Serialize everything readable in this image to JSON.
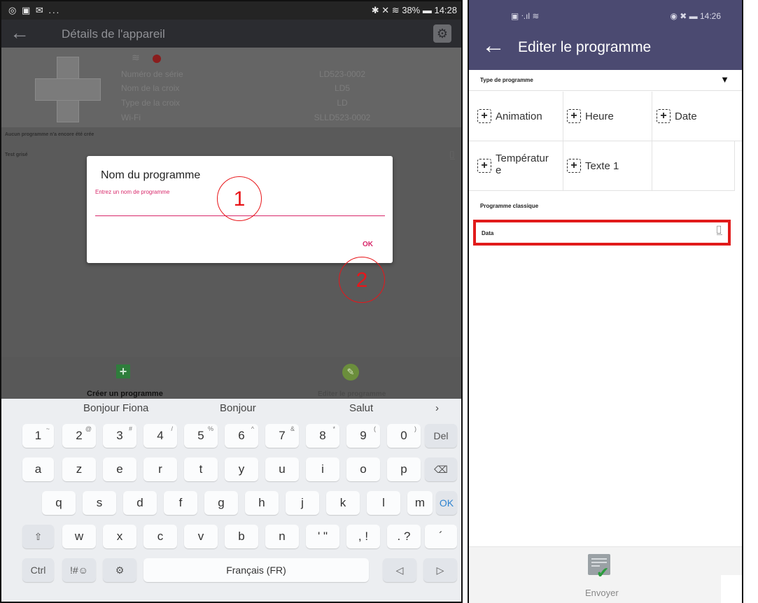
{
  "left": {
    "status": {
      "left_icons": "◎ ▣ ✉ ...",
      "right_text": "✱ ✕ ≋ 38% ▬ 14:28"
    },
    "appbar": {
      "title": "Détails de l'appareil"
    },
    "device": {
      "rows": [
        {
          "label": "Numéro de série",
          "value": "LD523-0002"
        },
        {
          "label": "Nom de la croix",
          "value": "LD5"
        },
        {
          "label": "Type de la croix",
          "value": "LD"
        },
        {
          "label": "Wi-Fi",
          "value": "SLLD523-0002"
        }
      ]
    },
    "no_program_text": "Aucun programme n'a encore été crée",
    "test_label": "Test grisé",
    "dialog": {
      "title": "Nom du programme",
      "placeholder": "Entrez un nom de programme",
      "ok": "OK"
    },
    "callouts": [
      "1",
      "2"
    ],
    "actions": {
      "create": "Créer un programme",
      "edit": "Editer le programme"
    },
    "keyboard": {
      "suggestions": [
        "Bonjour Fiona",
        "Bonjour",
        "Salut",
        "›"
      ],
      "row_numbers": [
        {
          "k": "1",
          "s": "~"
        },
        {
          "k": "2",
          "s": "@"
        },
        {
          "k": "3",
          "s": "#"
        },
        {
          "k": "4",
          "s": "/"
        },
        {
          "k": "5",
          "s": "%"
        },
        {
          "k": "6",
          "s": "^"
        },
        {
          "k": "7",
          "s": "&"
        },
        {
          "k": "8",
          "s": "*"
        },
        {
          "k": "9",
          "s": "("
        },
        {
          "k": "0",
          "s": ")"
        },
        {
          "k": "Del",
          "s": ""
        }
      ],
      "row1": [
        "a",
        "z",
        "e",
        "r",
        "t",
        "y",
        "u",
        "i",
        "o",
        "p",
        "⌫"
      ],
      "row2": [
        "q",
        "s",
        "d",
        "f",
        "g",
        "h",
        "j",
        "k",
        "l",
        "m",
        "OK"
      ],
      "row3": [
        "⇧",
        "w",
        "x",
        "c",
        "v",
        "b",
        "n",
        "' \"",
        ", !",
        ". ?",
        "´"
      ],
      "row4": [
        "Ctrl",
        "!#☺",
        "⚙",
        "Français (FR)",
        "◁",
        "▷"
      ]
    }
  },
  "right": {
    "status": {
      "left_icons": "▣ ᐧ.ıl ≋",
      "right_text": "◉ ✖ ▬ 14:26"
    },
    "appbar": {
      "title": "Editer le programme"
    },
    "type_label": "Type de programme",
    "grid": [
      "Animation",
      "Heure",
      "Date",
      "Températur\ne",
      "Texte 1",
      ""
    ],
    "classic_label": "Programme classique",
    "data_label": "Data",
    "send_label": "Envoyer"
  },
  "icons": {
    "back": "back-arrow-icon",
    "gear": "gear-icon",
    "wifi": "wifi-icon",
    "status_dot": "red-status-dot",
    "edit": "edit-icon",
    "plus": "plus-box-icon",
    "send": "send-document-icon"
  },
  "colors": {
    "left_appbar": "#2b2c30",
    "accent_pink": "#d8286a",
    "right_appbar": "#4b4a71",
    "highlight_red": "#e11b1b",
    "ok_blue": "#2f84d0"
  }
}
